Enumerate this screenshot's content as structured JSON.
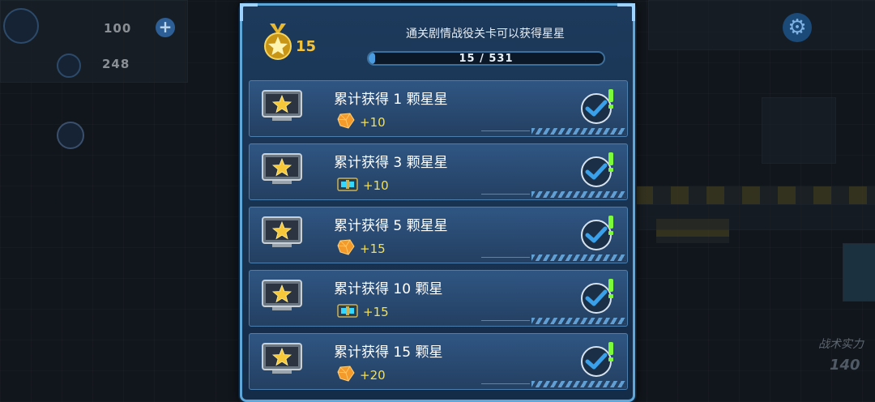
{
  "hud": {
    "resource_1": "100",
    "resource_2": "248",
    "tactical_power_label": "战术实力",
    "tactical_power_value": "140"
  },
  "panel": {
    "medal_count": "15",
    "hint": "通关剧情战役关卡可以获得星星",
    "progress_text": "15 / 531",
    "progress_fraction": 0.028
  },
  "rewards": [
    {
      "title": "累计获得 1 颗星星",
      "reward_icon": "gem-icon",
      "reward_value": "+10"
    },
    {
      "title": "累计获得 3 颗星星",
      "reward_icon": "chest-icon",
      "reward_value": "+10"
    },
    {
      "title": "累计获得 5 颗星星",
      "reward_icon": "gem-icon",
      "reward_value": "+15"
    },
    {
      "title": "累计获得 10 颗星",
      "reward_icon": "chest-icon",
      "reward_value": "+15"
    },
    {
      "title": "累计获得 15 颗星",
      "reward_icon": "gem-icon",
      "reward_value": "+20"
    }
  ],
  "colors": {
    "accent": "#5fa6d9",
    "reward_text": "#f6e04a",
    "medal": "#f4c33a",
    "check": "#3aa0ea",
    "exclaim": "#7cfb3a"
  }
}
